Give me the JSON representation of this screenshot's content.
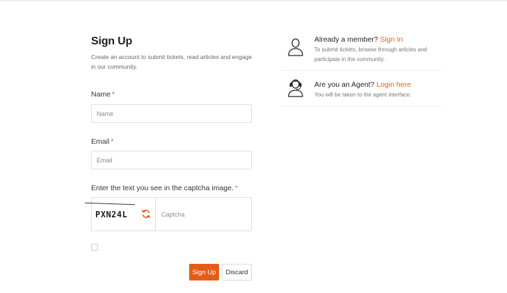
{
  "form": {
    "title": "Sign Up",
    "subtitle": "Create an account to submit tickets, read articles and engage in our community.",
    "name_label": "Name",
    "name_placeholder": "Name",
    "email_label": "Email",
    "email_placeholder": "Email",
    "captcha_label": "Enter the text you see in the captcha image.",
    "required_mark": "*",
    "captcha_text": "PXN24L",
    "captcha_placeholder": "Captcha",
    "signup_button": "Sign Up",
    "discard_button": "Discard"
  },
  "aside": {
    "member": {
      "prefix": "Already a member?",
      "link": "Sign In",
      "description": "To submit tickets, browse through articles and participate in the community."
    },
    "agent": {
      "prefix": "Are you an Agent?",
      "link": "Login here",
      "description": "You will be taken to the agent interface."
    }
  },
  "colors": {
    "accent": "#e35d1a",
    "border": "#dcdfe3"
  },
  "icons": {
    "member": "user-icon",
    "agent": "agent-headset-icon",
    "refresh": "refresh-icon"
  }
}
